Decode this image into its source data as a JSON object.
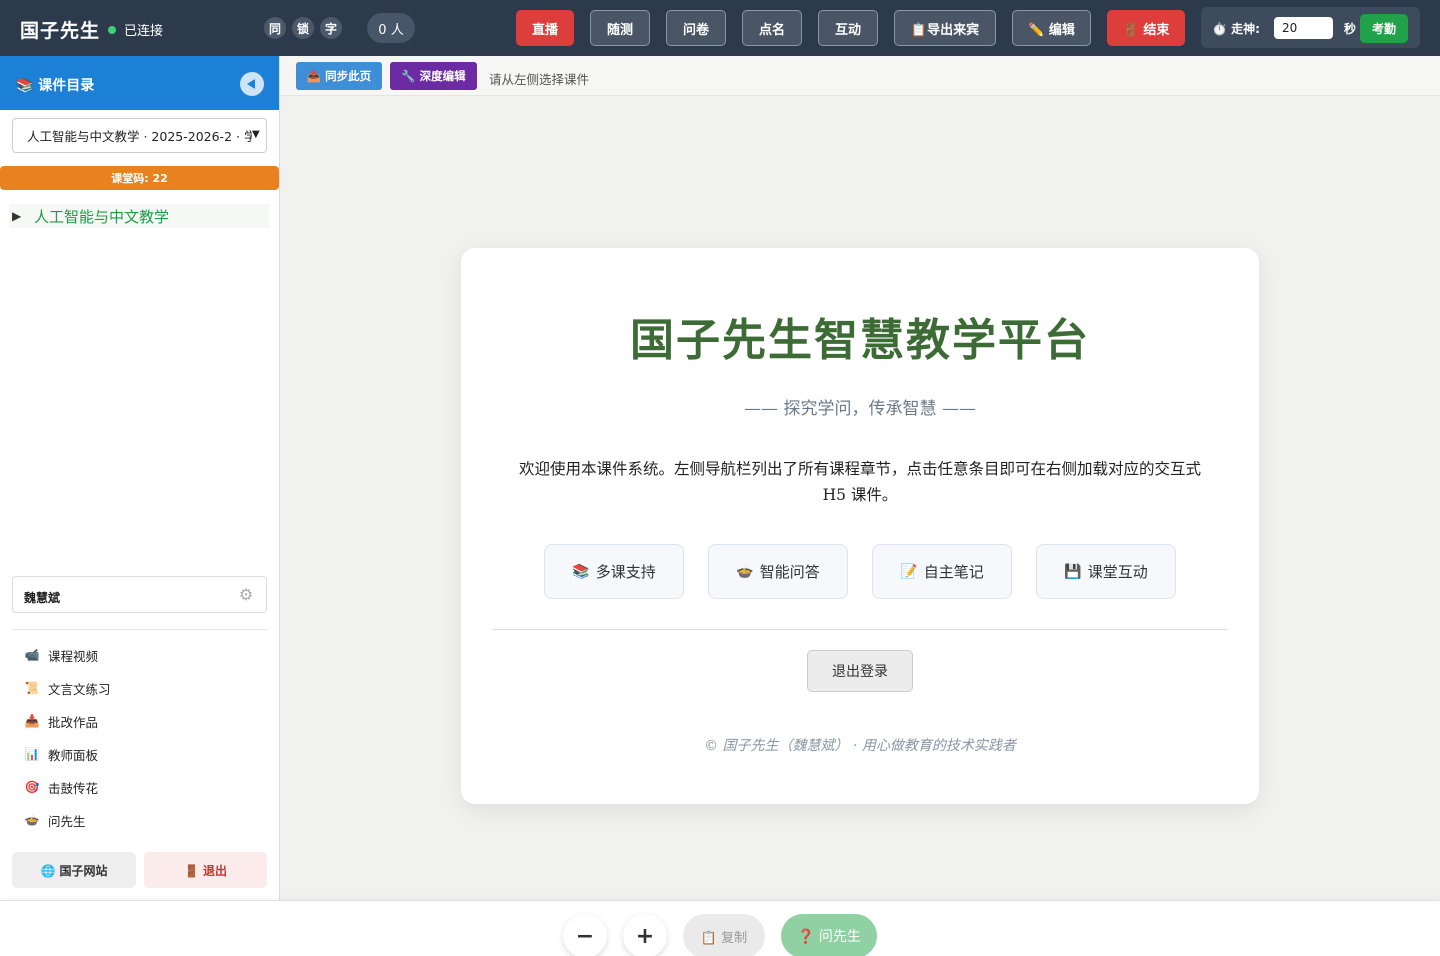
{
  "topbar": {
    "brand": "国子先生",
    "status": "已连接",
    "circles": [
      "同",
      "锁",
      "字"
    ],
    "online_count": "0 人",
    "buttons": [
      "直播",
      "随测",
      "问卷",
      "点名",
      "互动",
      "📋导出来宾",
      "✏️ 编辑",
      "🚪 结束"
    ],
    "timer": {
      "label": "⏱️ 走神:",
      "value": "20",
      "unit": "秒",
      "action": "考勤"
    }
  },
  "sidebar": {
    "title": "📚 课件目录",
    "course_select": "人工智能与中文教学 · 2025-2026-2 · 学",
    "room_code": "课堂码: 22",
    "tree": [
      {
        "label": "人工智能与中文教学"
      }
    ],
    "user_name": "魏慧斌",
    "menu": [
      {
        "icon": "📹",
        "label": "课程视频"
      },
      {
        "icon": "📜",
        "label": "文言文练习"
      },
      {
        "icon": "📥",
        "label": "批改作品"
      },
      {
        "icon": "📊",
        "label": "教师面板"
      },
      {
        "icon": "🎯",
        "label": "击鼓传花"
      },
      {
        "icon": "🍲",
        "label": "问先生"
      }
    ],
    "site_button": "🌐 国子网站",
    "logout_button": "🚪 退出"
  },
  "toolbar": {
    "sync": "📤 同步此页",
    "deep_edit": "🔧 深度编辑",
    "hint": "请从左侧选择课件"
  },
  "main": {
    "title": "国子先生智慧教学平台",
    "subtitle": "—— 探究学问，传承智慧 ——",
    "description": "欢迎使用本课件系统。左侧导航栏列出了所有课程章节，点击任意条目即可在右侧加载对应的交互式 H5 课件。",
    "features": [
      {
        "icon": "📚",
        "label": "多课支持"
      },
      {
        "icon": "🍲",
        "label": "智能问答"
      },
      {
        "icon": "📝",
        "label": "自主笔记"
      },
      {
        "icon": "💾",
        "label": "课堂互动"
      }
    ],
    "logout": "退出登录",
    "footer": "© 国子先生（魏慧斌） · 用心做教育的技术实践者"
  },
  "bottombar": {
    "zoom_out": "−",
    "zoom_in": "+",
    "copy": "📋 复制",
    "ask": "❓ 问先生"
  },
  "colors": {
    "topbar_bg": "#2c3a4b",
    "sidebar_header": "#1b80d6",
    "accent_green": "#3d6b35",
    "room_code_bg": "#e8821e",
    "danger": "#dd3d3b"
  }
}
